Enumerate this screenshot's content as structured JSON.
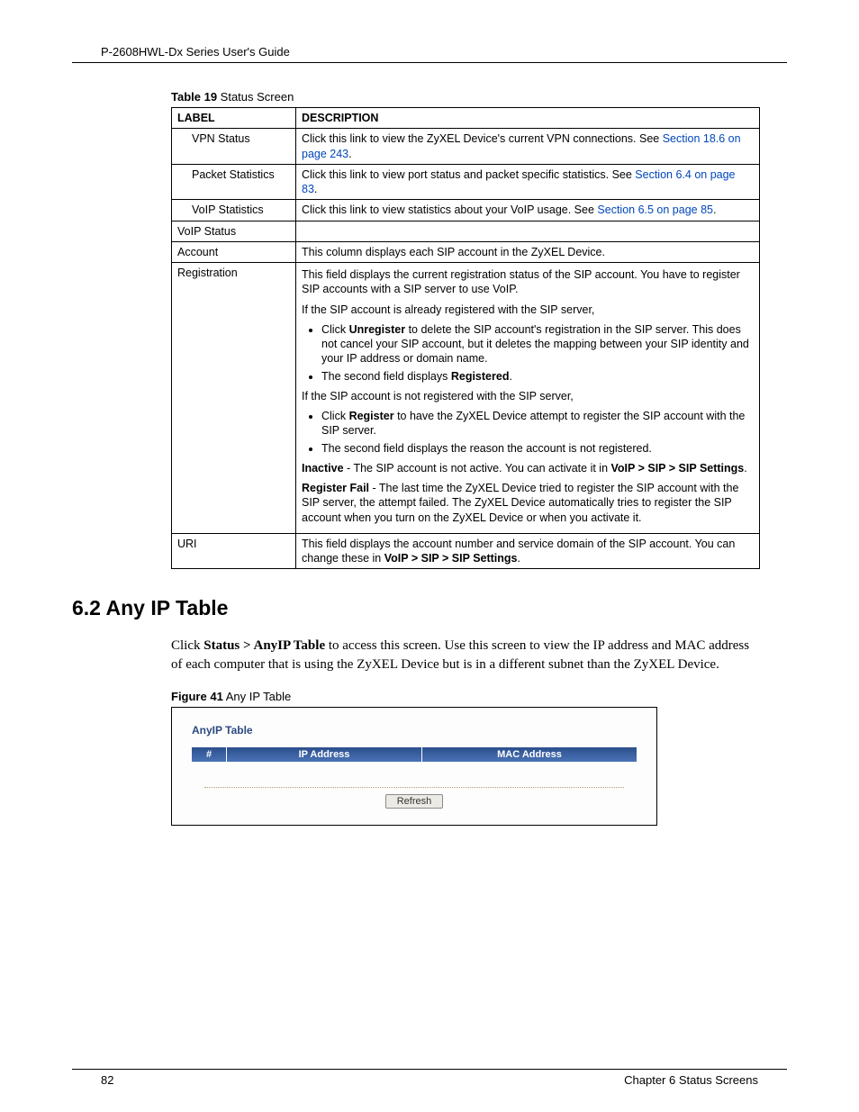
{
  "header": {
    "guide_title": "P-2608HWL-Dx Series User's Guide"
  },
  "table19": {
    "caption_bold": "Table 19",
    "caption_rest": "   Status Screen",
    "col_label": "LABEL",
    "col_desc": "DESCRIPTION",
    "rows": {
      "vpn_status": {
        "label": "VPN Status",
        "desc_pre": "Click this link to view the ZyXEL Device's current VPN connections. See ",
        "desc_link": "Section 18.6 on page 243",
        "desc_post": "."
      },
      "packet_stats": {
        "label": "Packet Statistics",
        "desc_pre": "Click this link to view port status and packet specific statistics. See ",
        "desc_link": "Section 6.4 on page 83",
        "desc_post": "."
      },
      "voip_stats": {
        "label": "VoIP Statistics",
        "desc_pre": "Click this link to view statistics about your VoIP usage. See ",
        "desc_link": "Section 6.5 on page 85",
        "desc_post": "."
      },
      "voip_status": {
        "label": "VoIP Status",
        "desc": ""
      },
      "account": {
        "label": "Account",
        "desc": "This column displays each SIP account in the ZyXEL Device."
      },
      "registration": {
        "label": "Registration",
        "p1": "This field displays the current registration status of the SIP account. You have to register SIP accounts with a SIP server to use VoIP.",
        "p2": "If the SIP account is already registered with the SIP server,",
        "b1_pre": "Click ",
        "b1_bold": "Unregister",
        "b1_post": " to delete the SIP account's registration in the SIP server. This does not cancel your SIP account, but it deletes the mapping between your SIP identity and your IP address or domain name.",
        "b2_pre": "The second field displays ",
        "b2_bold": "Registered",
        "b2_post": ".",
        "p3": "If the SIP account is not registered with the SIP server,",
        "b3_pre": "Click ",
        "b3_bold": "Register",
        "b3_post": " to have the ZyXEL Device attempt to register the SIP account with the SIP server.",
        "b4": "The second field displays the reason the account is not registered.",
        "p4_bold": "Inactive",
        "p4_mid": " - The SIP account is not active. You can activate it in ",
        "p4_bold2": "VoIP > SIP > SIP Settings",
        "p4_post": ".",
        "p5_bold": "Register Fail",
        "p5_post": " - The last time the ZyXEL Device tried to register the SIP account with the SIP server, the attempt failed. The ZyXEL Device automatically tries to register the SIP account when you turn on the ZyXEL Device or when you activate it."
      },
      "uri": {
        "label": "URI",
        "desc_pre": "This field displays the account number and service domain of the SIP account. You can change these in ",
        "desc_bold": "VoIP > SIP > SIP Settings",
        "desc_post": "."
      }
    }
  },
  "section": {
    "heading": "6.2  Any IP Table",
    "body_pre": "Click ",
    "body_bold": "Status > AnyIP Table",
    "body_post": " to access this screen. Use this screen to view the IP address and MAC address of each computer that is using the ZyXEL Device but is in a different subnet than the ZyXEL Device."
  },
  "figure41": {
    "caption_bold": "Figure 41",
    "caption_rest": "   Any IP Table",
    "panel_title": "AnyIP Table",
    "col_num": "#",
    "col_ip": "IP Address",
    "col_mac": "MAC Address",
    "refresh": "Refresh"
  },
  "footer": {
    "page_number": "82",
    "chapter": "Chapter 6 Status Screens"
  }
}
